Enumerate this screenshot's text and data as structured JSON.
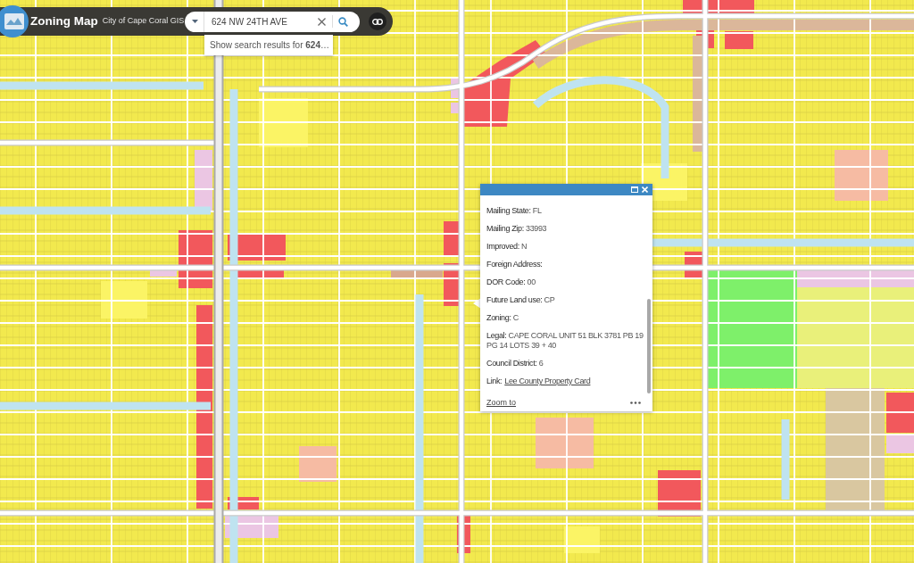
{
  "header": {
    "title": "Zoning Map",
    "subtitle": "City of Cape Coral GIS"
  },
  "search": {
    "value": "624 NW 24TH AVE",
    "suggestion": "Show search results for **624**…"
  },
  "popup": {
    "fields": [
      {
        "kind": "text",
        "label": "Mailing State:",
        "value": "FL"
      },
      {
        "kind": "text",
        "label": "Mailing Zip:",
        "value": "33993"
      },
      {
        "kind": "text",
        "label": "Improved:",
        "value": "N"
      },
      {
        "kind": "text",
        "label": "Foreign Address:"
      },
      {
        "kind": "text",
        "label": "DOR Code:",
        "value": "00"
      },
      {
        "kind": "text",
        "label": "Future Land use:",
        "value": "CP"
      },
      {
        "kind": "text",
        "label": "Zoning:",
        "value": "C"
      },
      {
        "kind": "text",
        "label": "Legal:",
        "value": "CAPE CORAL UNIT 51 BLK 3781 PB 19 PG 14 LOTS 39 + 40"
      },
      {
        "kind": "text",
        "label": "Council District:",
        "value": "6"
      },
      {
        "kind": "link",
        "label": "Link:",
        "value": "Lee County Property Card"
      }
    ],
    "zoom_link": "Zoom to"
  }
}
